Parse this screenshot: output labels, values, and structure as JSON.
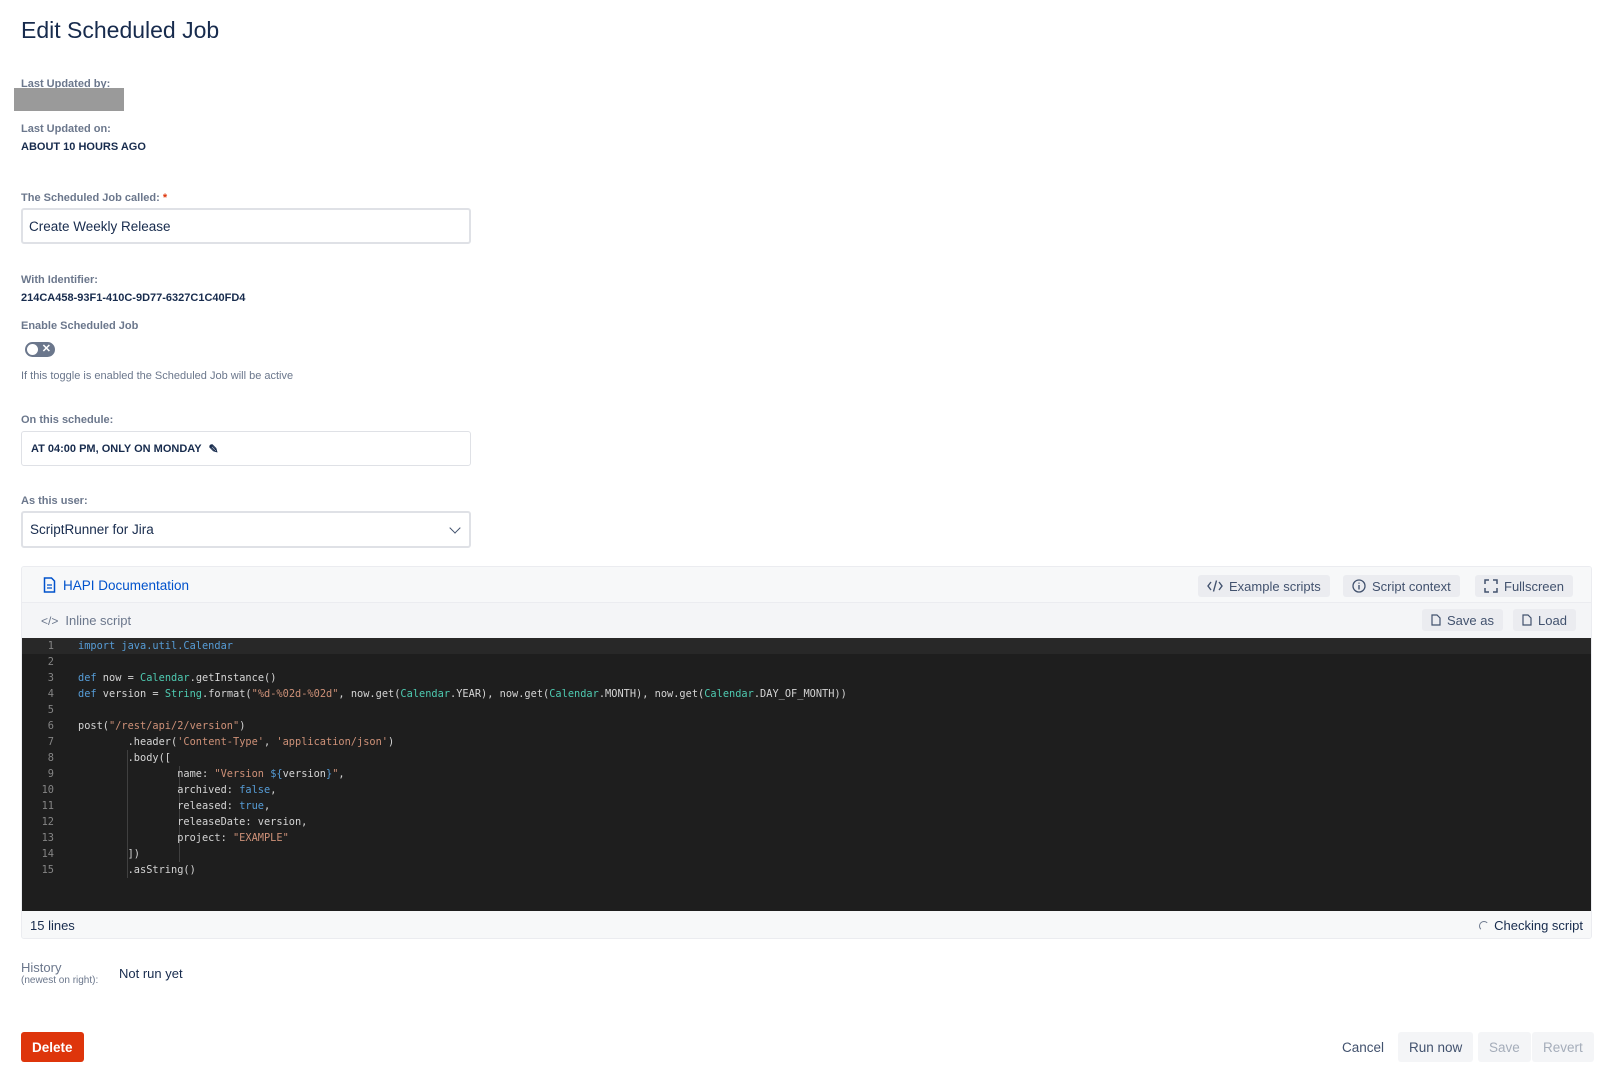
{
  "page": {
    "title": "Edit Scheduled Job"
  },
  "meta": {
    "last_updated_by_label": "Last Updated by:",
    "last_updated_on_label": "Last Updated on:",
    "last_updated_on_value": "ABOUT 10 HOURS AGO"
  },
  "job_name": {
    "label": "The Scheduled Job called:",
    "required_mark": "*",
    "value": "Create Weekly Release"
  },
  "identifier": {
    "label": "With Identifier:",
    "value": "214CA458-93F1-410C-9D77-6327C1C40FD4"
  },
  "enable": {
    "label": "Enable Scheduled Job",
    "enabled": false,
    "help": "If this toggle is enabled the Scheduled Job will be active"
  },
  "schedule": {
    "label": "On this schedule:",
    "value": "AT 04:00 PM, ONLY ON MONDAY"
  },
  "user": {
    "label": "As this user:",
    "value": "ScriptRunner for Jira"
  },
  "editor": {
    "doc_link": "HAPI Documentation",
    "example_scripts": "Example scripts",
    "script_context": "Script context",
    "fullscreen": "Fullscreen",
    "inline_script": "Inline script",
    "save_as": "Save as",
    "load": "Load",
    "line_count": "15 lines",
    "status": "Checking script",
    "lines": [
      "import java.util.Calendar",
      "",
      "def now = Calendar.getInstance()",
      "def version = String.format(\"%d-%02d-%02d\", now.get(Calendar.YEAR), now.get(Calendar.MONTH), now.get(Calendar.DAY_OF_MONTH))",
      "",
      "post(\"/rest/api/2/version\")",
      "        .header('Content-Type', 'application/json')",
      "        .body([",
      "                name: \"Version ${version}\",",
      "                archived: false,",
      "                released: true,",
      "                releaseDate: version,",
      "                project: \"EXAMPLE\"",
      "        ])",
      "        .asString()"
    ]
  },
  "history": {
    "label": "History",
    "sublabel": "(newest on right):",
    "value": "Not run yet"
  },
  "actions": {
    "delete": "Delete",
    "cancel": "Cancel",
    "run_now": "Run now",
    "save": "Save",
    "revert": "Revert"
  }
}
